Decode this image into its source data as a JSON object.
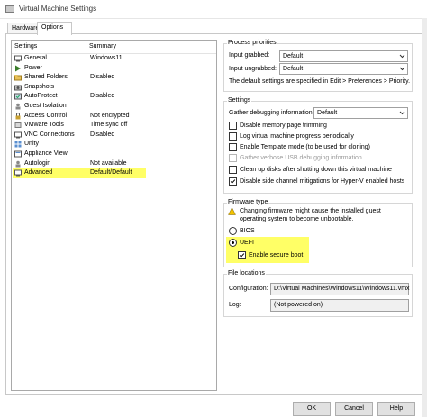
{
  "window": {
    "title": "Virtual Machine Settings"
  },
  "tabs": [
    {
      "label": "Hardware"
    },
    {
      "label": "Options"
    }
  ],
  "list": {
    "col_settings": "Settings",
    "col_summary": "Summary",
    "items": [
      {
        "label": "General",
        "summary": "Windows11",
        "icon": "general-icon"
      },
      {
        "label": "Power",
        "summary": "",
        "icon": "power-play-icon"
      },
      {
        "label": "Shared Folders",
        "summary": "Disabled",
        "icon": "shared-folders-icon"
      },
      {
        "label": "Snapshots",
        "summary": "",
        "icon": "snapshots-icon"
      },
      {
        "label": "AutoProtect",
        "summary": "Disabled",
        "icon": "autoprotect-icon"
      },
      {
        "label": "Guest Isolation",
        "summary": "",
        "icon": "guest-isolation-icon"
      },
      {
        "label": "Access Control",
        "summary": "Not encrypted",
        "icon": "access-control-icon"
      },
      {
        "label": "VMware Tools",
        "summary": "Time sync off",
        "icon": "vmware-tools-icon"
      },
      {
        "label": "VNC Connections",
        "summary": "Disabled",
        "icon": "vnc-icon"
      },
      {
        "label": "Unity",
        "summary": "",
        "icon": "unity-icon"
      },
      {
        "label": "Appliance View",
        "summary": "",
        "icon": "appliance-view-icon"
      },
      {
        "label": "Autologin",
        "summary": "Not available",
        "icon": "autologin-icon"
      },
      {
        "label": "Advanced",
        "summary": "Default/Default",
        "icon": "advanced-icon"
      }
    ]
  },
  "process_priorities": {
    "legend": "Process priorities",
    "input_grabbed_label": "Input grabbed:",
    "input_grabbed_value": "Default",
    "input_ungrabbed_label": "Input ungrabbed:",
    "input_ungrabbed_value": "Default",
    "note": "The default settings are specified in Edit > Preferences > Priority."
  },
  "settings": {
    "legend": "Settings",
    "gather_label": "Gather debugging information:",
    "gather_value": "Default",
    "checkboxes": [
      {
        "label": "Disable memory page trimming",
        "checked": false
      },
      {
        "label": "Log virtual machine progress periodically",
        "checked": false
      },
      {
        "label": "Enable Template mode (to be used for cloning)",
        "checked": false
      },
      {
        "label": "Gather verbose USB debugging information",
        "checked": false
      },
      {
        "label": "Clean up disks after shutting down this virtual machine",
        "checked": false
      },
      {
        "label": "Disable side channel mitigations for Hyper-V enabled hosts",
        "checked": true
      }
    ]
  },
  "firmware": {
    "legend": "Firmware type",
    "warning": "Changing firmware might cause the installed guest operating system to become unbootable.",
    "bios_label": "BIOS",
    "uefi_label": "UEFI",
    "secure_boot_label": "Enable secure boot"
  },
  "file_locations": {
    "legend": "File locations",
    "configuration_label": "Configuration:",
    "configuration_value": "D:\\Virtual Machines\\Windows11\\Windows11.vmx",
    "log_label": "Log:",
    "log_value": "(Not powered on)"
  },
  "buttons": {
    "ok": "OK",
    "cancel": "Cancel",
    "help": "Help"
  },
  "colors": {
    "highlight": "#ffff66"
  }
}
